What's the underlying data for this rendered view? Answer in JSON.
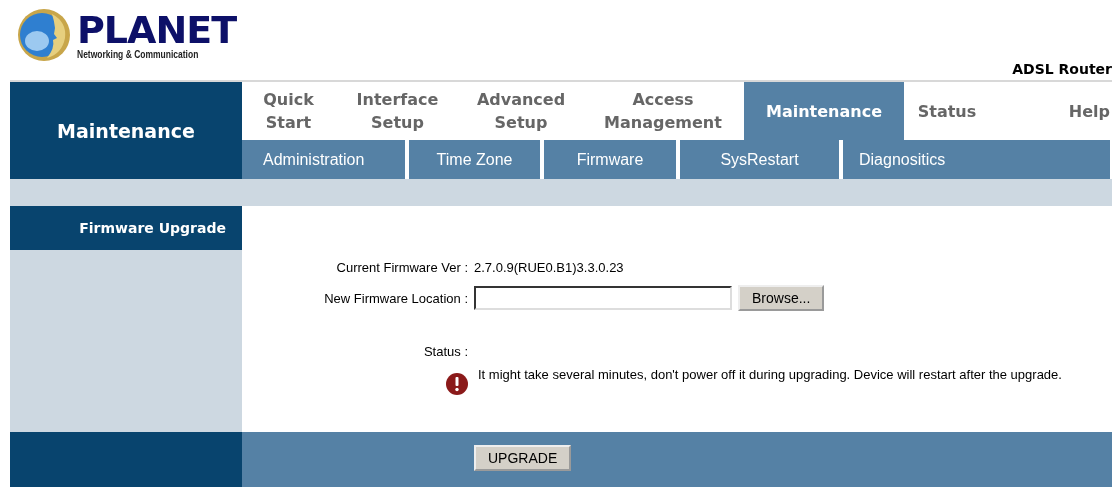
{
  "header": {
    "logo_name": "PLANET",
    "logo_tagline": "Networking & Communication",
    "product": "ADSL Router"
  },
  "section_title": "Maintenance",
  "tabs": [
    {
      "label": "Quick\nStart",
      "selected": false
    },
    {
      "label": "Interface\nSetup",
      "selected": false
    },
    {
      "label": "Advanced\nSetup",
      "selected": false
    },
    {
      "label": "Access\nManagement",
      "selected": false
    },
    {
      "label": "Maintenance",
      "selected": true
    },
    {
      "label": "Status",
      "selected": false
    },
    {
      "label": "Help",
      "selected": false
    }
  ],
  "subtabs": [
    "Administration",
    "Time Zone",
    "Firmware",
    "SysRestart",
    "Diagnositics"
  ],
  "side_title": "Firmware Upgrade",
  "form": {
    "version_label": "Current Firmware Ver :",
    "version_value": "2.7.0.9(RUE0.B1)3.3.0.23",
    "location_label": "New Firmware Location :",
    "browse_button": "Browse...",
    "status_label": "Status :",
    "message": "It might take several minutes, don't power off it during upgrading. Device will restart after the upgrade."
  },
  "upgrade_button": "UPGRADE"
}
